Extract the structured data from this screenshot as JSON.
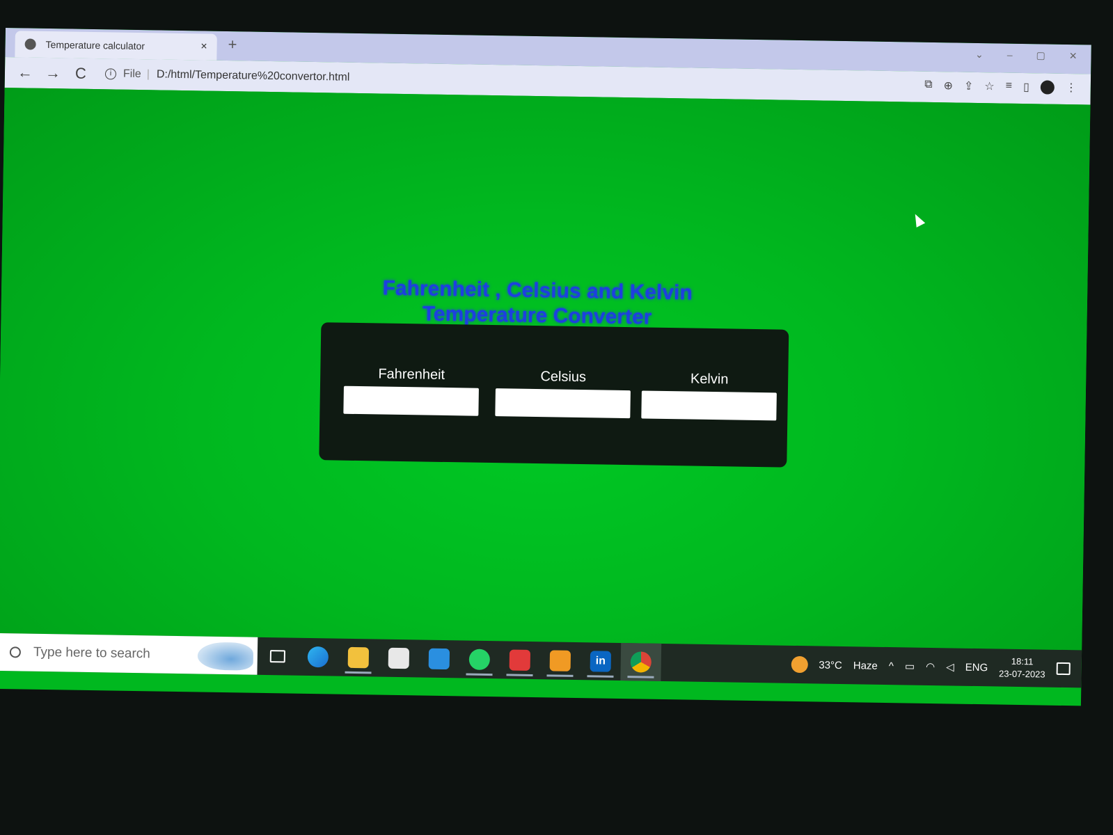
{
  "browser": {
    "tab_title": "Temperature calculator",
    "tab_close": "×",
    "new_tab": "+",
    "nav_back": "←",
    "nav_forward": "→",
    "nav_reload": "C",
    "info_glyph": "i",
    "file_label": "File",
    "separator": "|",
    "url": "D:/html/Temperature%20convertor.html",
    "window_controls": [
      "⌄",
      "–",
      "▢",
      "✕"
    ],
    "toolbar_icons": [
      "translate-icon",
      "zoom-icon",
      "share-icon",
      "star-icon",
      "reading-list-icon",
      "side-panel-icon",
      "profile-avatar",
      "menu-icon"
    ]
  },
  "page": {
    "background_color": "#00b81f",
    "heading_line1": "Fahrenheit , Celsius and Kelvin",
    "heading_line2": "Temperature Converter",
    "heading_color": "#1d3fe0",
    "fields": [
      {
        "label": "Fahrenheit",
        "value": ""
      },
      {
        "label": "Celsius",
        "value": ""
      },
      {
        "label": "Kelvin",
        "value": ""
      }
    ]
  },
  "taskbar": {
    "search_placeholder": "Type here to search",
    "apps": [
      "task-view-icon",
      "edge-icon",
      "file-explorer-icon",
      "store-icon",
      "mail-icon",
      "whatsapp-icon",
      "app-red-icon",
      "sublime-icon",
      "linkedin-icon",
      "chrome-icon"
    ],
    "linkedin_text": "in",
    "weather_temp": "33°C",
    "weather_desc": "Haze",
    "tray_chevron": "^",
    "language": "ENG",
    "time": "18:11",
    "date": "23-07-2023"
  }
}
